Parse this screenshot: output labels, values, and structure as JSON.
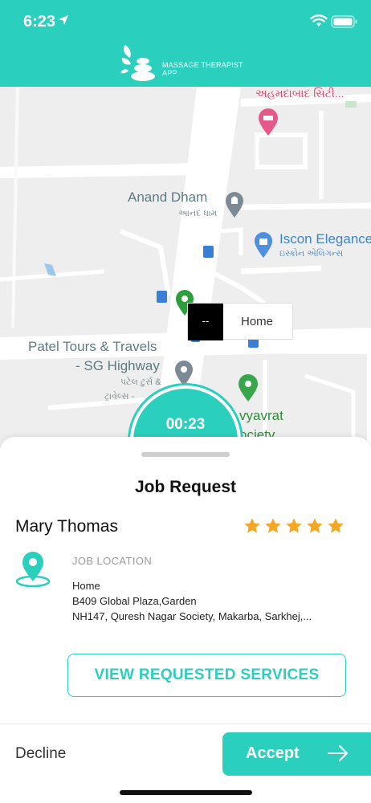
{
  "status_bar": {
    "time": "6:23"
  },
  "header": {
    "app_name": "MASSAGE THERAPIST APP"
  },
  "map": {
    "labels": {
      "top_gujarati": "અહમદાબાદ સિટી...",
      "anand_dham": "Anand Dham",
      "anand_dham_sub": "આનંદ ધામ",
      "iscon": "Iscon Elegance",
      "iscon_sub": "ઇસ્કોન એલિગન્સ",
      "patel_tours_1": "Patel Tours & Travels",
      "patel_tours_2": "- SG Highway",
      "patel_sub_1": "પટેલ ટુર્સ &",
      "patel_sub_2": "ટ્રાવેલ્સ -",
      "divyavrat_1": "vyavrat",
      "divyavrat_2": "ociety"
    },
    "callout": {
      "code": "--",
      "label": "Home"
    }
  },
  "timer": {
    "value": "00:23"
  },
  "job_request": {
    "title": "Job Request",
    "client_name": "Mary Thomas",
    "rating": 5,
    "location_heading": "JOB LOCATION",
    "location_lines": [
      "Home",
      "B409 Global Plaza,Garden",
      "NH147, Quresh Nagar Society, Makarba, Sarkhej,..."
    ],
    "view_services_label": "VIEW REQUESTED SERVICES"
  },
  "actions": {
    "decline_label": "Decline",
    "accept_label": "Accept"
  },
  "colors": {
    "accent": "#2bcfbd",
    "star": "#f5a623"
  }
}
